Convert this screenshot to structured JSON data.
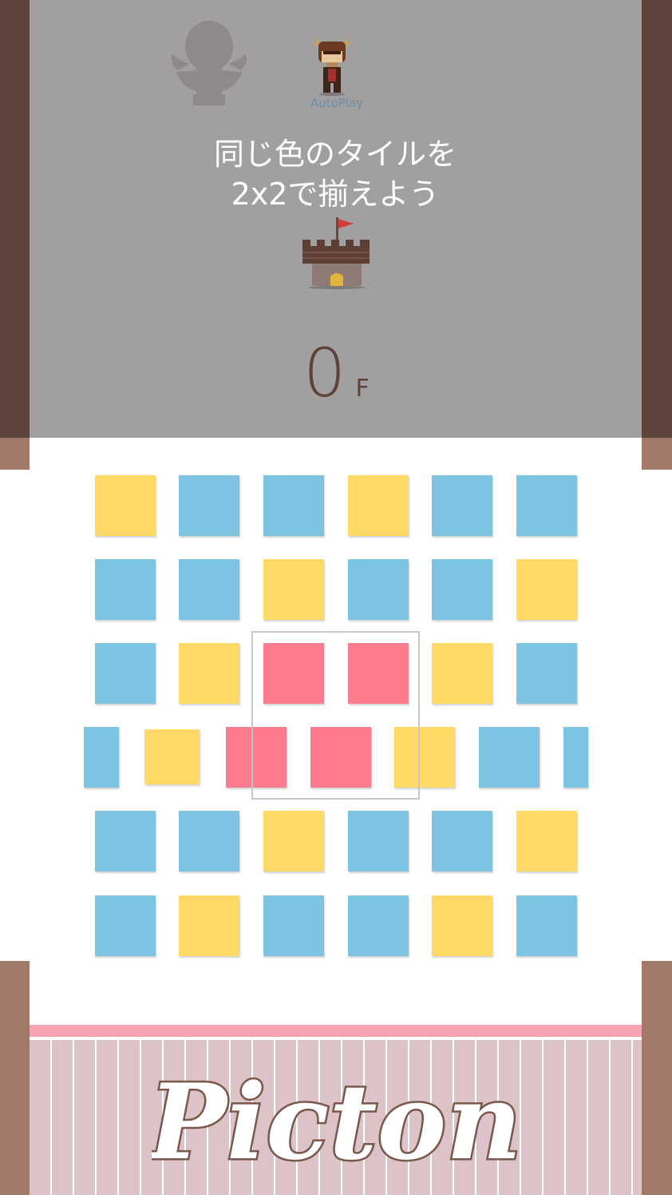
{
  "header": {
    "autoplay_label": "AutoPlay",
    "instruction_line1": "同じ色のタイルを",
    "instruction_line2": "2x2で揃えよう",
    "floor_value": "0",
    "floor_unit": "F"
  },
  "characters": [
    {
      "name": "angel-icon",
      "state": "locked"
    },
    {
      "name": "knight-icon",
      "label": "AutoPlay"
    }
  ],
  "colors": {
    "yellow": "#ffd966",
    "blue": "#7cc4e1",
    "pink": "#fd7b8e"
  },
  "board": {
    "rows": [
      [
        "yellow",
        "blue",
        "blue",
        "yellow",
        "blue",
        "blue"
      ],
      [
        "blue",
        "blue",
        "yellow",
        "blue",
        "blue",
        "yellow"
      ],
      [
        "blue",
        "yellow",
        "pink",
        "pink",
        "yellow",
        "blue"
      ],
      [
        "blue",
        "yellow",
        "pink",
        "pink",
        "yellow",
        "blue",
        "blue"
      ],
      [
        "blue",
        "blue",
        "yellow",
        "blue",
        "blue",
        "yellow"
      ],
      [
        "blue",
        "yellow",
        "blue",
        "blue",
        "yellow",
        "blue"
      ]
    ]
  },
  "footer": {
    "logo_text": "Picton"
  }
}
